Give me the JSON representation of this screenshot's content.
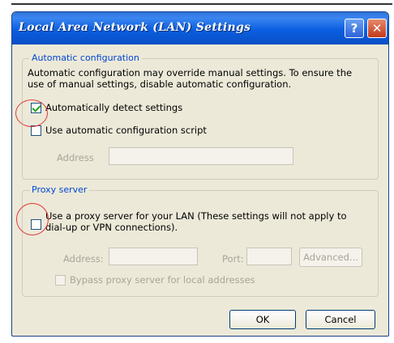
{
  "window": {
    "title": "Local Area Network (LAN) Settings",
    "help_glyph": "?",
    "close_glyph": "✕"
  },
  "auto_config": {
    "legend": "Automatic configuration",
    "description_line1": "Automatic configuration may override manual settings.  To ensure the",
    "description_line2": "use of manual settings, disable automatic configuration.",
    "detect_label": "Automatically detect settings",
    "detect_checked": true,
    "script_label": "Use automatic configuration script",
    "script_checked": false,
    "address_label": "Address",
    "address_value": ""
  },
  "proxy": {
    "legend": "Proxy server",
    "use_proxy_line1": "Use a proxy server for your LAN (These settings will not apply to",
    "use_proxy_line2": "dial-up or VPN connections).",
    "use_proxy_checked": false,
    "address_label": "Address:",
    "address_value": "",
    "port_label": "Port:",
    "port_value": "",
    "advanced_label": "Advanced...",
    "bypass_label": "Bypass proxy server for local addresses",
    "bypass_checked": false
  },
  "buttons": {
    "ok": "OK",
    "cancel": "Cancel"
  },
  "annotation_color": "#e23a3a"
}
